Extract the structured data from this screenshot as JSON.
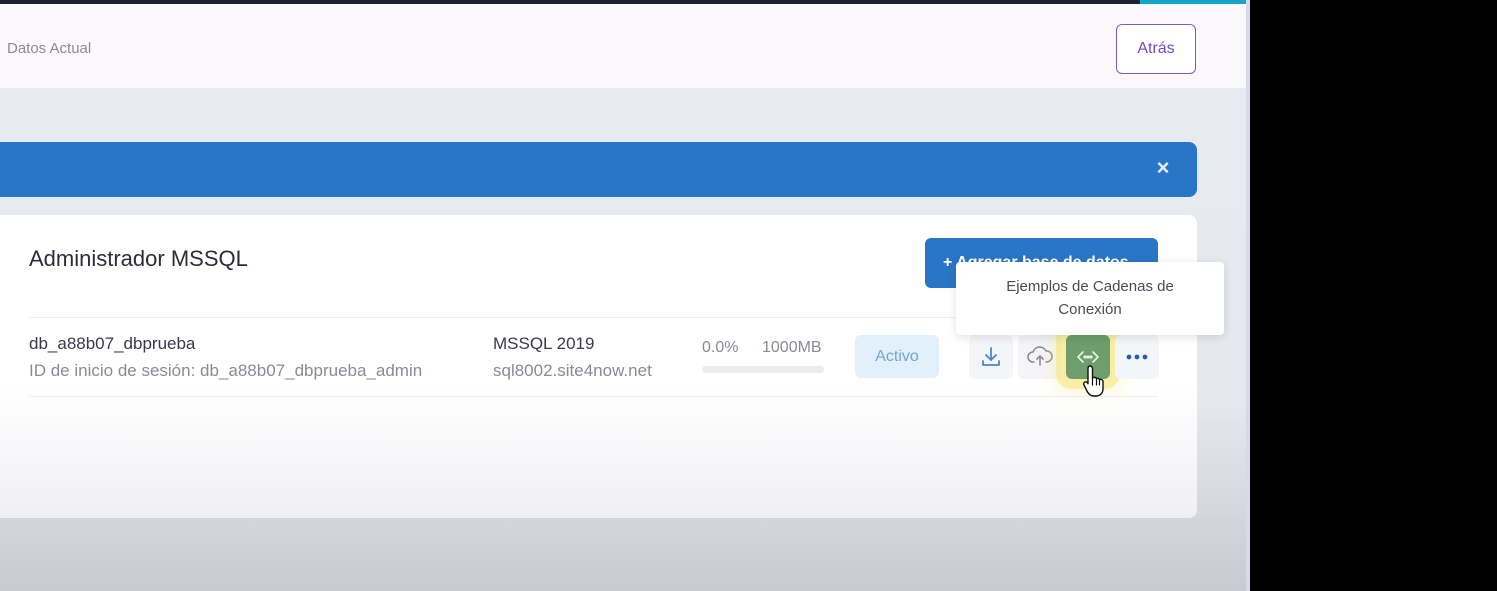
{
  "header": {
    "breadcrumb": "Datos Actual",
    "back_label": "Atrás"
  },
  "banner": {
    "close_symbol": "×"
  },
  "panel": {
    "title": "Administrador MSSQL",
    "add_button_label": "+ Agregar base de datos"
  },
  "database": {
    "name": "db_a88b07_dbprueba",
    "login": "ID de inicio de sesión: db_a88b07_dbprueba_admin",
    "version": "MSSQL 2019",
    "server": "sql8002.site4now.net",
    "usage_percent": "0.0%",
    "usage_fraction": 0.0,
    "quota": "1000MB",
    "status": "Activo",
    "actions": [
      "download-icon",
      "cloud-upload-icon",
      "connection-string-icon",
      "more-icon"
    ]
  },
  "tooltip": {
    "line1": "Ejemplos de Cadenas de",
    "line2": "Conexión"
  },
  "colors": {
    "primary": "#2a76c6",
    "accent_purple": "#6a4ccc",
    "status_bg": "#e2f0fb",
    "active_action": "#6e9e6b"
  }
}
